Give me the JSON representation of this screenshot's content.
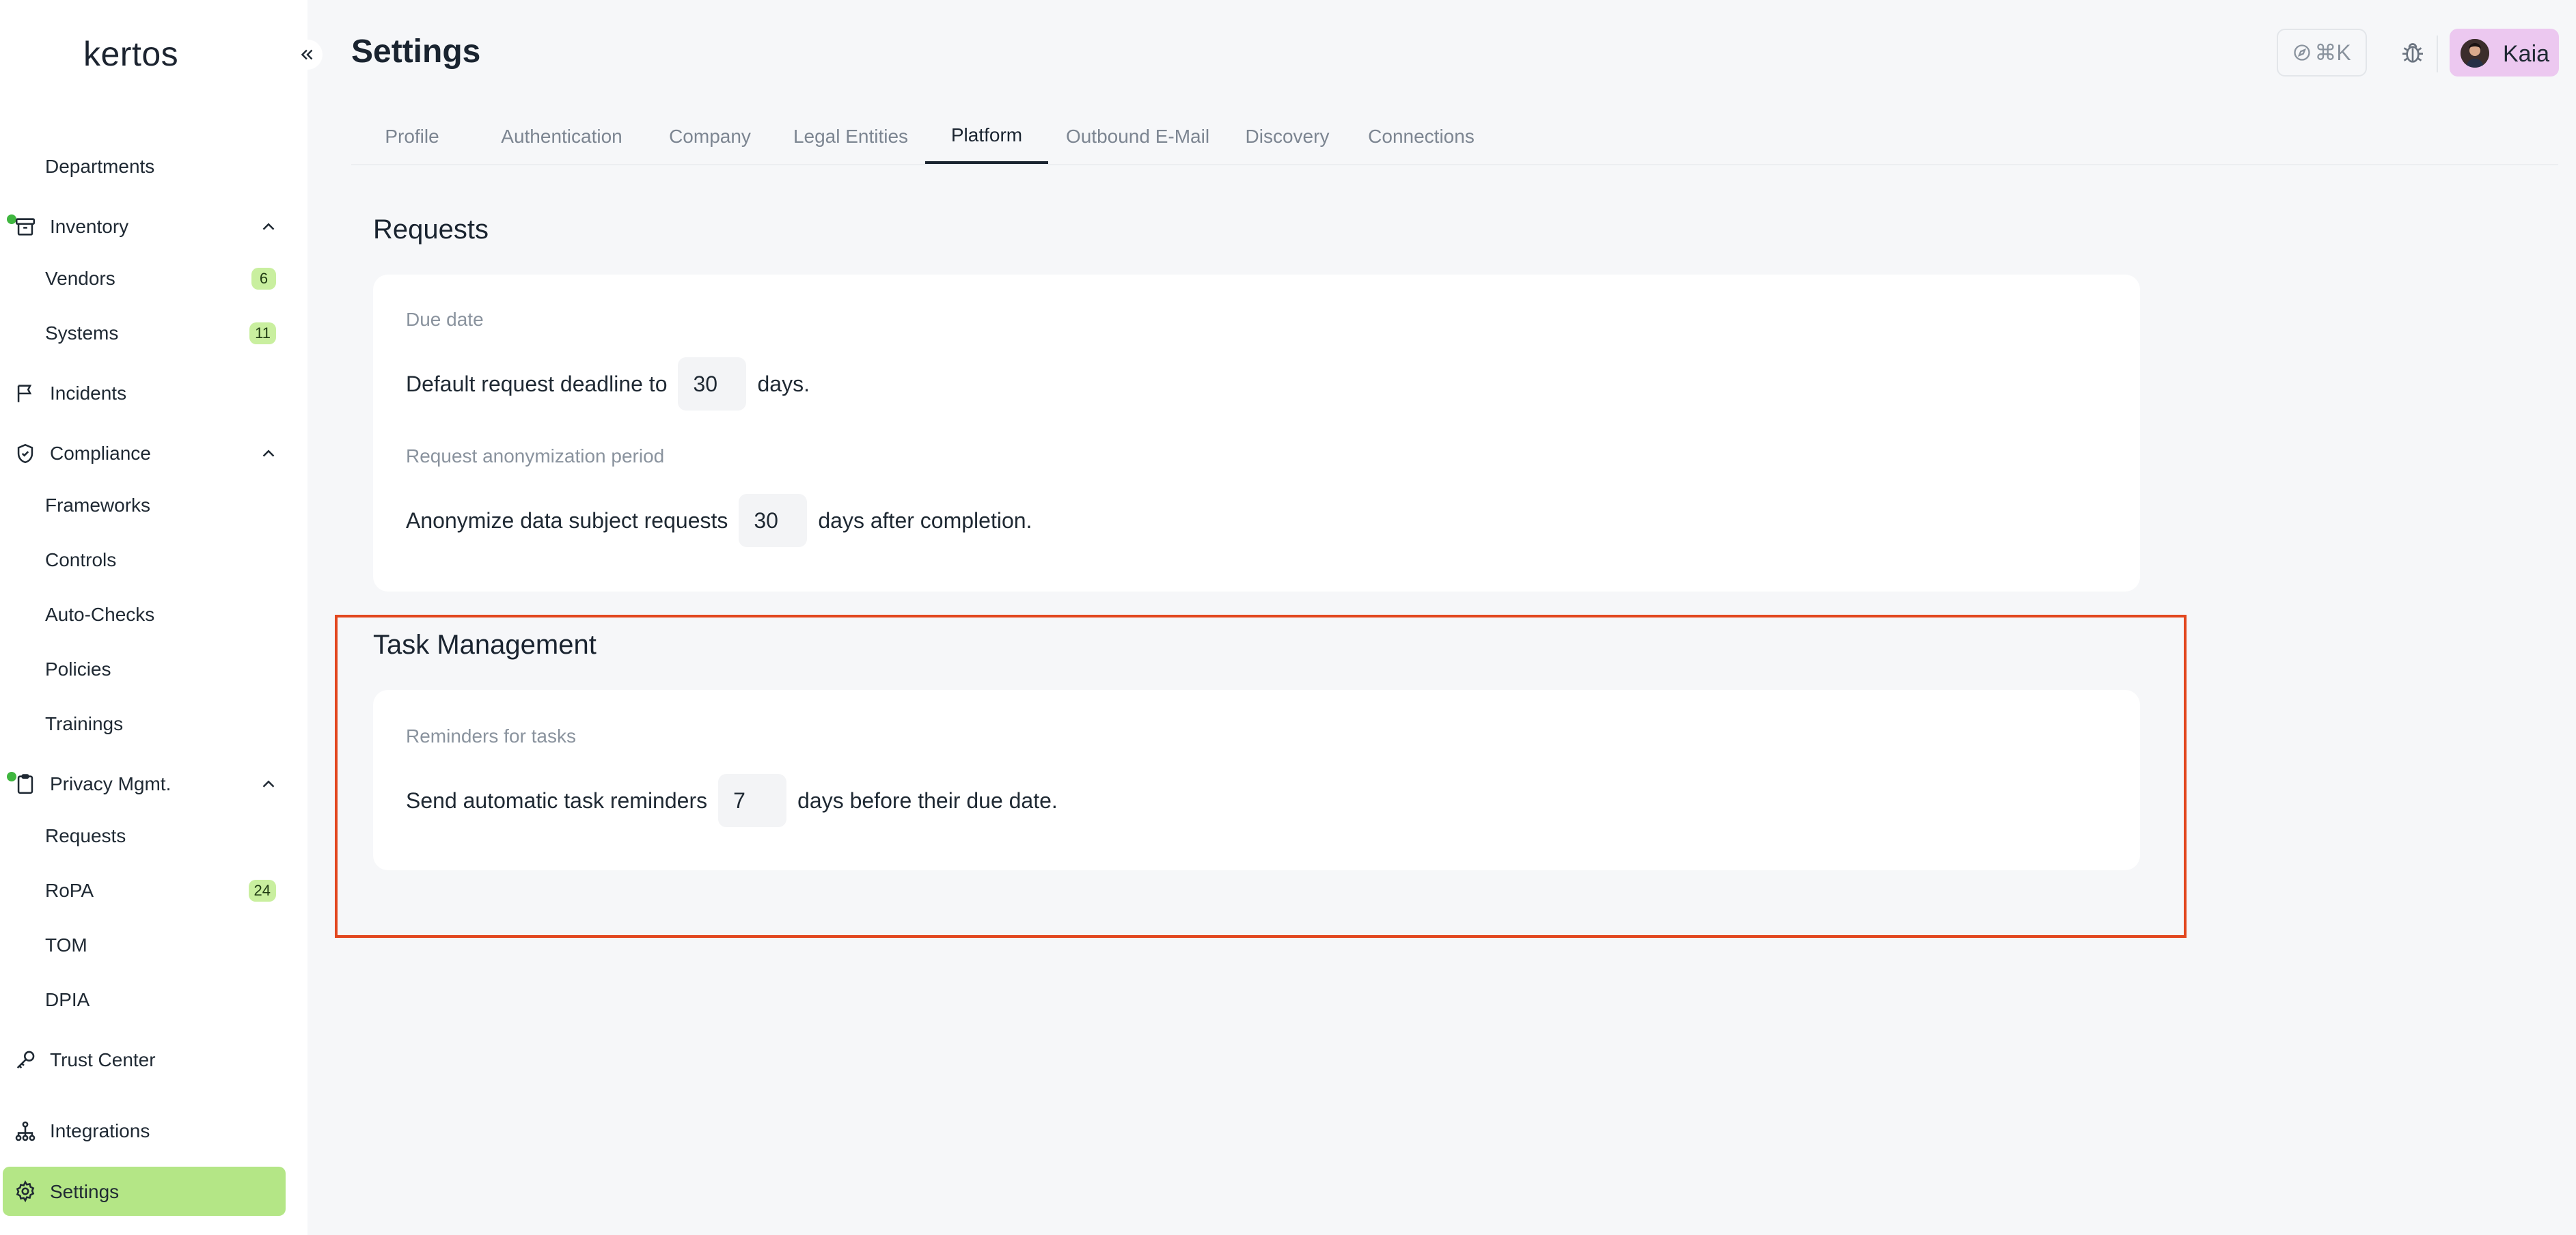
{
  "app": {
    "logo": "kertos",
    "page_title": "Settings"
  },
  "header": {
    "shortcut_label": "⌘K",
    "user_name": "Kaia"
  },
  "sidebar": {
    "departments": "Departments",
    "inventory": {
      "label": "Inventory",
      "vendors": "Vendors",
      "vendors_count": "6",
      "systems": "Systems",
      "systems_count": "11"
    },
    "incidents": "Incidents",
    "compliance": {
      "label": "Compliance",
      "frameworks": "Frameworks",
      "controls": "Controls",
      "auto_checks": "Auto-Checks",
      "policies": "Policies",
      "trainings": "Trainings"
    },
    "privacy": {
      "label": "Privacy Mgmt.",
      "requests": "Requests",
      "ropa": "RoPA",
      "ropa_count": "24",
      "tom": "TOM",
      "dpia": "DPIA"
    },
    "trust_center": "Trust Center",
    "integrations": "Integrations",
    "settings": "Settings"
  },
  "tabs": [
    "Profile",
    "Authentication",
    "Company",
    "Legal Entities",
    "Platform",
    "Outbound E-Mail",
    "Discovery",
    "Connections"
  ],
  "active_tab": "Platform",
  "requests": {
    "title": "Requests",
    "due_date_label": "Due date",
    "due_date_prefix": "Default request deadline to",
    "due_date_value": "30",
    "due_date_suffix": "days.",
    "anon_label": "Request anonymization period",
    "anon_prefix": "Anonymize data subject requests",
    "anon_value": "30",
    "anon_suffix": "days after completion."
  },
  "tasks": {
    "title": "Task Management",
    "reminder_label": "Reminders for tasks",
    "reminder_prefix": "Send automatic task reminders",
    "reminder_value": "7",
    "reminder_suffix": "days before their due date."
  },
  "colors": {
    "accent_green": "#b4e686",
    "badge_green": "#c9ef9f",
    "highlight": "#e2471f",
    "user_chip": "#ecc8f0"
  }
}
